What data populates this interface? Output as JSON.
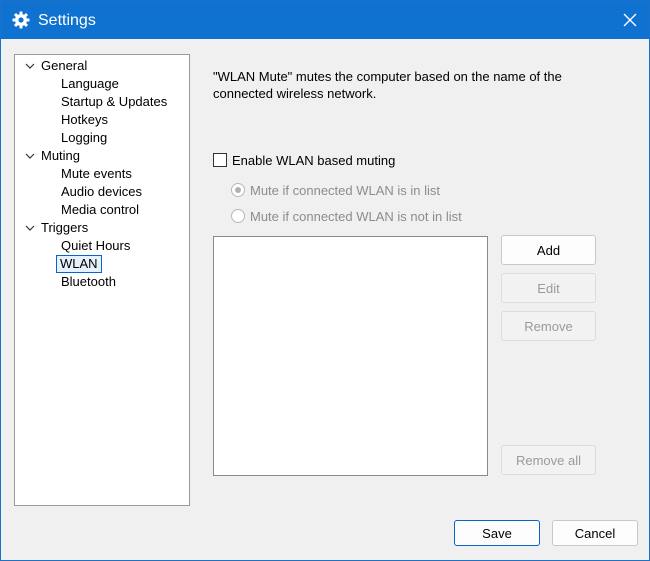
{
  "window": {
    "title": "Settings",
    "icons": {
      "app": "gear-icon",
      "close": "close-icon"
    },
    "accent_color": "#0f72d1"
  },
  "tree": {
    "groups": [
      {
        "label": "General",
        "expanded": true,
        "children": [
          "Language",
          "Startup & Updates",
          "Hotkeys",
          "Logging"
        ]
      },
      {
        "label": "Muting",
        "expanded": true,
        "children": [
          "Mute events",
          "Audio devices",
          "Media control"
        ]
      },
      {
        "label": "Triggers",
        "expanded": true,
        "children": [
          "Quiet Hours",
          "WLAN",
          "Bluetooth"
        ]
      }
    ],
    "selected": "WLAN"
  },
  "panel": {
    "description_line1": "\"WLAN Mute\" mutes the computer based on the name of the",
    "description_line2": "connected wireless network.",
    "enable_checkbox": {
      "label": "Enable WLAN based muting",
      "checked": false
    },
    "radio_in_list": {
      "label": "Mute if connected WLAN is in list",
      "checked": true,
      "enabled": false
    },
    "radio_not_in_list": {
      "label": "Mute if connected WLAN is not in list",
      "checked": false,
      "enabled": false
    },
    "wlan_list": [],
    "buttons": {
      "add": "Add",
      "edit": "Edit",
      "remove": "Remove",
      "remove_all": "Remove all"
    }
  },
  "footer": {
    "save": "Save",
    "cancel": "Cancel"
  }
}
